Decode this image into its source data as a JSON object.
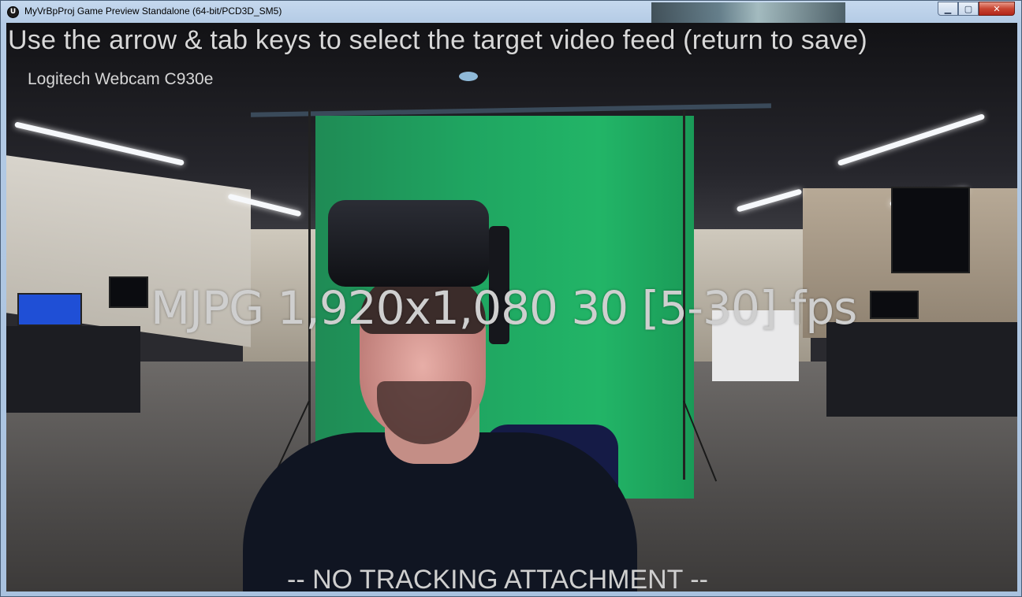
{
  "window": {
    "title": "MyVrBpProj Game Preview Standalone (64-bit/PCD3D_SM5)",
    "app_icon": "unreal-engine-icon",
    "app_icon_glyph": "U",
    "buttons": {
      "minimize_glyph": "▁",
      "maximize_glyph": "▢",
      "close_glyph": "✕"
    }
  },
  "overlay": {
    "instruction": "Use the arrow & tab keys to select the target video feed (return to save)",
    "device_name": "Logitech Webcam C930e",
    "video_format": "MJPG 1,920x1,080 30 [5-30] fps",
    "tracking_status": "-- NO TRACKING ATTACHMENT --"
  },
  "colors": {
    "overlay_text": "#d8d8d8",
    "greenscreen": "#1fa561",
    "close_button": "#c84531"
  }
}
